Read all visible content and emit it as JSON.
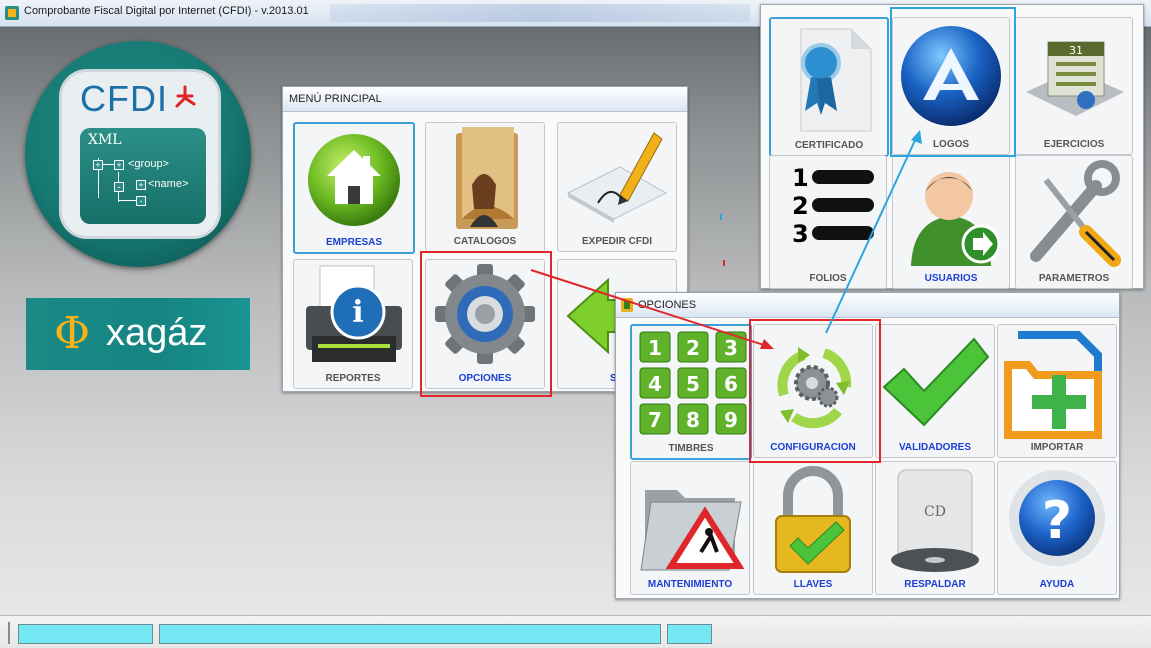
{
  "window": {
    "title": "Comprobante Fiscal Digital por Internet (CFDI) - v.2013.01"
  },
  "logo": {
    "text": "CFDI",
    "xml_label": "XML",
    "tree_items": [
      "<group>",
      "<name>"
    ]
  },
  "brand": {
    "symbol": "Φ",
    "text": "xagáz"
  },
  "menu_principal": {
    "title": "MENÚ PRINCIPAL",
    "tiles": [
      {
        "label": "EMPRESAS",
        "icon": "home-icon"
      },
      {
        "label": "CATALOGOS",
        "icon": "folder-person-icon"
      },
      {
        "label": "EXPEDIR CFDI",
        "icon": "pen-paper-icon"
      },
      {
        "label": "REPORTES",
        "icon": "printer-info-icon"
      },
      {
        "label": "OPCIONES",
        "icon": "gear-icon"
      },
      {
        "label": "SA",
        "icon": "arrow-left-icon"
      }
    ]
  },
  "opciones": {
    "title": "OPCIONES",
    "tiles": [
      {
        "label": "TIMBRES",
        "icon": "number-grid-icon",
        "numbers": [
          "1",
          "2",
          "3",
          "4",
          "5",
          "6",
          "7",
          "8",
          "9"
        ]
      },
      {
        "label": "CONFIGURACION",
        "icon": "gears-recycle-icon"
      },
      {
        "label": "VALIDADORES",
        "icon": "checkmark-icon"
      },
      {
        "label": "IMPORTAR",
        "icon": "import-plus-icon"
      },
      {
        "label": "MANTENIMIENTO",
        "icon": "maintenance-folder-icon"
      },
      {
        "label": "LLAVES",
        "icon": "padlock-icon"
      },
      {
        "label": "RESPALDAR",
        "icon": "cd-drive-icon",
        "disc_text": "CD"
      },
      {
        "label": "AYUDA",
        "icon": "help-icon",
        "glyph": "?"
      }
    ]
  },
  "configuracion": {
    "tiles": [
      {
        "label": "CERTIFICADO",
        "icon": "certificate-icon"
      },
      {
        "label": "LOGOS",
        "icon": "logo-globe-icon"
      },
      {
        "label": "EJERCICIOS",
        "icon": "calendar-icon",
        "calendar_day": "31"
      },
      {
        "label": "FOLIOS",
        "icon": "numbered-list-icon",
        "numbers": [
          "1",
          "2",
          "3"
        ]
      },
      {
        "label": "USUARIOS",
        "icon": "user-arrow-icon"
      },
      {
        "label": "PARAMETROS",
        "icon": "tools-icon"
      }
    ]
  },
  "colors": {
    "highlight_red": "#e0262b",
    "highlight_blue": "#2ea4dc",
    "label_blue": "#1b3ed6",
    "status_cell": "#74e8f3",
    "brand_teal": "#1a8a87"
  }
}
